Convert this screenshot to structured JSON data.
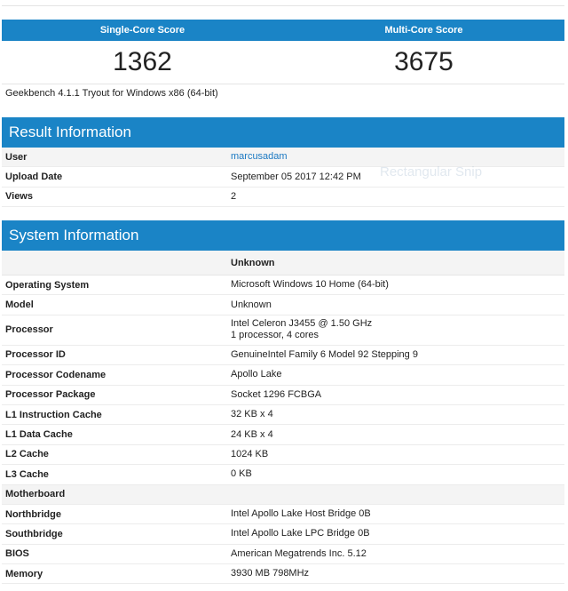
{
  "scores": {
    "single_label": "Single-Core Score",
    "multi_label": "Multi-Core Score",
    "single_value": "1362",
    "multi_value": "3675"
  },
  "version_text": "Geekbench 4.1.1 Tryout for Windows x86 (64-bit)",
  "result": {
    "title": "Result Information",
    "rows": [
      {
        "key": "User",
        "value": "marcusadam"
      },
      {
        "key": "Upload Date",
        "value": "September 05 2017 12:42 PM"
      },
      {
        "key": "Views",
        "value": "2"
      }
    ]
  },
  "watermark": "Rectangular Snip",
  "system": {
    "title": "System Information",
    "column_header": "Unknown",
    "rows": [
      {
        "key": "Operating System",
        "value": "Microsoft Windows 10 Home (64-bit)"
      },
      {
        "key": "Model",
        "value": "Unknown"
      },
      {
        "key": "Processor",
        "value": "Intel Celeron J3455 @ 1.50 GHz",
        "value2": "1 processor, 4 cores"
      },
      {
        "key": "Processor ID",
        "value": "GenuineIntel Family 6 Model 92 Stepping 9"
      },
      {
        "key": "Processor Codename",
        "value": "Apollo Lake"
      },
      {
        "key": "Processor Package",
        "value": "Socket 1296 FCBGA"
      },
      {
        "key": "L1 Instruction Cache",
        "value": "32 KB x 4"
      },
      {
        "key": "L1 Data Cache",
        "value": "24 KB x 4"
      },
      {
        "key": "L2 Cache",
        "value": "1024 KB"
      },
      {
        "key": "L3 Cache",
        "value": "0 KB"
      },
      {
        "key": "Motherboard",
        "value": ""
      },
      {
        "key": "Northbridge",
        "value": "Intel Apollo Lake Host Bridge 0B"
      },
      {
        "key": "Southbridge",
        "value": "Intel Apollo Lake LPC Bridge 0B"
      },
      {
        "key": "BIOS",
        "value": "American Megatrends Inc. 5.12"
      },
      {
        "key": "Memory",
        "value": "3930 MB 798MHz"
      }
    ]
  }
}
